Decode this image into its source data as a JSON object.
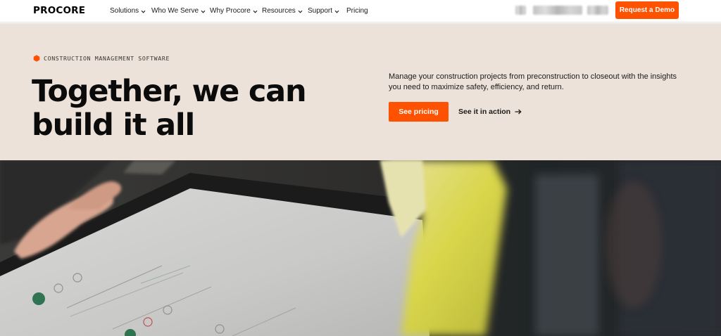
{
  "nav": {
    "logo": "PROCORE",
    "items": [
      {
        "label": "Solutions",
        "has_menu": true
      },
      {
        "label": "Who We Serve",
        "has_menu": true
      },
      {
        "label": "Why Procore",
        "has_menu": true
      },
      {
        "label": "Resources",
        "has_menu": true
      },
      {
        "label": "Support",
        "has_menu": true
      },
      {
        "label": "Pricing",
        "has_menu": false
      }
    ],
    "cta": "Request a Demo"
  },
  "hero": {
    "eyebrow": "CONSTRUCTION MANAGEMENT SOFTWARE",
    "headline_line1": "Together, we can",
    "headline_line2": "build it all",
    "subcopy": "Manage your construction projects from preconstruction to closeout with the insights you need to maximize safety, efficiency, and return.",
    "primary_button": "See pricing",
    "secondary_link": "See it in action"
  },
  "colors": {
    "brand_orange": "#ff5200",
    "hero_background": "#ece2d9",
    "text_dark": "#0b0b0b"
  },
  "icons": {
    "eyebrow": "hexagon-icon",
    "nav_menu": "chevron-down-icon",
    "secondary_link": "arrow-right-icon"
  }
}
